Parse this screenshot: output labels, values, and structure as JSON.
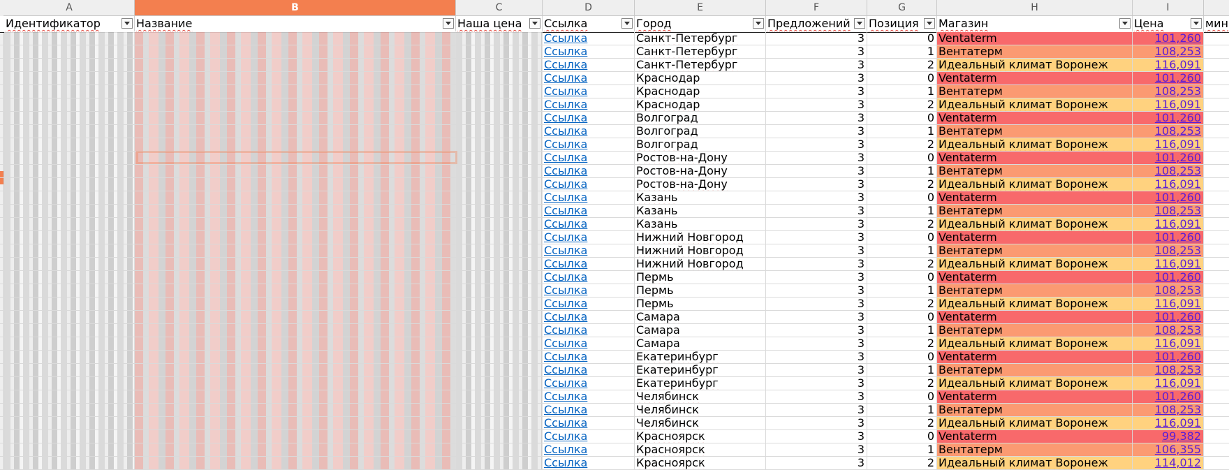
{
  "columns_header": [
    "A",
    "B",
    "C",
    "D",
    "E",
    "F",
    "G",
    "H",
    "I"
  ],
  "selected_column": "B",
  "headers": {
    "id": "Идентификатор",
    "name": "Название",
    "our_price": "Наша цена",
    "link": "Ссылка",
    "city": "Город",
    "offers": "Предложений",
    "position": "Позиция",
    "shop": "Магазин",
    "price": "Цена",
    "min": "мин"
  },
  "colors": {
    "pos0": "#f8696b",
    "pos1": "#fb9a72",
    "pos2": "#ffd27f",
    "selected": "#f37f4f",
    "link": "#0563c1"
  },
  "rows": [
    {
      "link": "Ссылка",
      "city": "Санкт-Петербург",
      "offers": "3",
      "position": "0",
      "shop": "Ventaterm",
      "price": "101,260"
    },
    {
      "link": "Ссылка",
      "city": "Санкт-Петербург",
      "offers": "3",
      "position": "1",
      "shop": "Вентатерм",
      "price": "108,253"
    },
    {
      "link": "Ссылка",
      "city": "Санкт-Петербург",
      "offers": "3",
      "position": "2",
      "shop": "Идеальный климат Воронеж",
      "price": "116,091"
    },
    {
      "link": "Ссылка",
      "city": "Краснодар",
      "offers": "3",
      "position": "0",
      "shop": "Ventaterm",
      "price": "101,260"
    },
    {
      "link": "Ссылка",
      "city": "Краснодар",
      "offers": "3",
      "position": "1",
      "shop": "Вентатерм",
      "price": "108,253"
    },
    {
      "link": "Ссылка",
      "city": "Краснодар",
      "offers": "3",
      "position": "2",
      "shop": "Идеальный климат Воронеж",
      "price": "116,091"
    },
    {
      "link": "Ссылка",
      "city": "Волгоград",
      "offers": "3",
      "position": "0",
      "shop": "Ventaterm",
      "price": "101,260"
    },
    {
      "link": "Ссылка",
      "city": "Волгоград",
      "offers": "3",
      "position": "1",
      "shop": "Вентатерм",
      "price": "108,253"
    },
    {
      "link": "Ссылка",
      "city": "Волгоград",
      "offers": "3",
      "position": "2",
      "shop": "Идеальный климат Воронеж",
      "price": "116,091"
    },
    {
      "link": "Ссылка",
      "city": "Ростов-на-Дону",
      "offers": "3",
      "position": "0",
      "shop": "Ventaterm",
      "price": "101,260"
    },
    {
      "link": "Ссылка",
      "city": "Ростов-на-Дону",
      "offers": "3",
      "position": "1",
      "shop": "Вентатерм",
      "price": "108,253"
    },
    {
      "link": "Ссылка",
      "city": "Ростов-на-Дону",
      "offers": "3",
      "position": "2",
      "shop": "Идеальный климат Воронеж",
      "price": "116,091"
    },
    {
      "link": "Ссылка",
      "city": "Казань",
      "offers": "3",
      "position": "0",
      "shop": "Ventaterm",
      "price": "101,260"
    },
    {
      "link": "Ссылка",
      "city": "Казань",
      "offers": "3",
      "position": "1",
      "shop": "Вентатерм",
      "price": "108,253"
    },
    {
      "link": "Ссылка",
      "city": "Казань",
      "offers": "3",
      "position": "2",
      "shop": "Идеальный климат Воронеж",
      "price": "116,091"
    },
    {
      "link": "Ссылка",
      "city": "Нижний Новгород",
      "offers": "3",
      "position": "0",
      "shop": "Ventaterm",
      "price": "101,260"
    },
    {
      "link": "Ссылка",
      "city": "Нижний Новгород",
      "offers": "3",
      "position": "1",
      "shop": "Вентатерм",
      "price": "108,253"
    },
    {
      "link": "Ссылка",
      "city": "Нижний Новгород",
      "offers": "3",
      "position": "2",
      "shop": "Идеальный климат Воронеж",
      "price": "116,091"
    },
    {
      "link": "Ссылка",
      "city": "Пермь",
      "offers": "3",
      "position": "0",
      "shop": "Ventaterm",
      "price": "101,260"
    },
    {
      "link": "Ссылка",
      "city": "Пермь",
      "offers": "3",
      "position": "1",
      "shop": "Вентатерм",
      "price": "108,253"
    },
    {
      "link": "Ссылка",
      "city": "Пермь",
      "offers": "3",
      "position": "2",
      "shop": "Идеальный климат Воронеж",
      "price": "116,091"
    },
    {
      "link": "Ссылка",
      "city": "Самара",
      "offers": "3",
      "position": "0",
      "shop": "Ventaterm",
      "price": "101,260"
    },
    {
      "link": "Ссылка",
      "city": "Самара",
      "offers": "3",
      "position": "1",
      "shop": "Вентатерм",
      "price": "108,253"
    },
    {
      "link": "Ссылка",
      "city": "Самара",
      "offers": "3",
      "position": "2",
      "shop": "Идеальный климат Воронеж",
      "price": "116,091"
    },
    {
      "link": "Ссылка",
      "city": "Екатеринбург",
      "offers": "3",
      "position": "0",
      "shop": "Ventaterm",
      "price": "101,260"
    },
    {
      "link": "Ссылка",
      "city": "Екатеринбург",
      "offers": "3",
      "position": "1",
      "shop": "Вентатерм",
      "price": "108,253"
    },
    {
      "link": "Ссылка",
      "city": "Екатеринбург",
      "offers": "3",
      "position": "2",
      "shop": "Идеальный климат Воронеж",
      "price": "116,091"
    },
    {
      "link": "Ссылка",
      "city": "Челябинск",
      "offers": "3",
      "position": "0",
      "shop": "Ventaterm",
      "price": "101,260"
    },
    {
      "link": "Ссылка",
      "city": "Челябинск",
      "offers": "3",
      "position": "1",
      "shop": "Вентатерм",
      "price": "108,253"
    },
    {
      "link": "Ссылка",
      "city": "Челябинск",
      "offers": "3",
      "position": "2",
      "shop": "Идеальный климат Воронеж",
      "price": "116,091"
    },
    {
      "link": "Ссылка",
      "city": "Красноярск",
      "offers": "3",
      "position": "0",
      "shop": "Ventaterm",
      "price": "99,382"
    },
    {
      "link": "Ссылка",
      "city": "Красноярск",
      "offers": "3",
      "position": "1",
      "shop": "Вентатерм",
      "price": "106,355"
    },
    {
      "link": "Ссылка",
      "city": "Красноярск",
      "offers": "3",
      "position": "2",
      "shop": "Идеальный климат Воронеж",
      "price": "114,012"
    }
  ]
}
